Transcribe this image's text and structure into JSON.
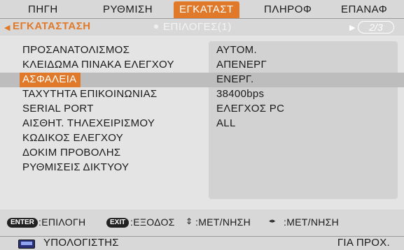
{
  "tabs": [
    "ΠΗΓΗ",
    "ΡΥΘΜΙΣΗ",
    "ΕΓΚΑΤΑΣΤ",
    "ΠΛΗΡΟΦ",
    "ΕΠΑΝΑΦ"
  ],
  "active_tab": "ΕΓΚΑΤΑΣΤ",
  "subbar": {
    "section": "ΕΓΚΑΤΑΣΤΑΣΗ",
    "options": "ΕΠΙΛΟΓΕΣ(1)",
    "page": "2/3"
  },
  "rows": [
    {
      "label": "ΠΡΟΣΑΝΑΤΟΛΙΣΜΟΣ",
      "value": "ΑΥΤΟΜ."
    },
    {
      "label": "ΚΛΕΙΔΩΜΑ ΠΙΝΑΚΑ ΕΛΕΓΧΟΥ",
      "value": "ΑΠΕΝΕΡΓ"
    },
    {
      "label": "ΑΣΦΑΛΕΙΑ",
      "value": "ΕΝΕΡΓ.",
      "selected": true
    },
    {
      "label": "ΤΑΧΥΤΗΤΑ ΕΠΙΚΟΙΝΩΝΙΑΣ",
      "value": "38400bps"
    },
    {
      "label": "SERIAL PORT",
      "value": "ΕΛΕΓΧΟΣ PC"
    },
    {
      "label": "ΑΙΣΘΗΤ. ΤΗΛΕΧΕΙΡΙΣΜΟΥ",
      "value": "ALL"
    },
    {
      "label": "ΚΩΔΙΚΟΣ ΕΛΕΓΧΟΥ",
      "value": ""
    },
    {
      "label": "ΔΟΚΙΜ ΠΡΟΒΟΛΗΣ",
      "value": ""
    },
    {
      "label": "ΡΥΘΜΙΣΕΙΣ ΔΙΚΤΥΟΥ",
      "value": ""
    }
  ],
  "footer": {
    "enter_btn": "ENTER",
    "enter_text": ":ΕΠΙΛΟΓΗ",
    "exit_btn": "EXIT",
    "exit_text": ":ΕΞΟΔΟΣ",
    "updown_symbol": "⇕",
    "updown_text": ":ΜΕΤ/ΝΗΣΗ",
    "leftright_symbol": "◂▸",
    "leftright_text": ":ΜΕΤ/ΝΗΣΗ"
  },
  "status": {
    "source": "ΥΠΟΛΟΓΙΣΤΗΣ",
    "info": "ΓΙΑ ΠΡΟΧ."
  },
  "colors": {
    "accent": "#e07a2a",
    "panel": "#e4e4e4",
    "value_box": "#d2d2d2"
  }
}
